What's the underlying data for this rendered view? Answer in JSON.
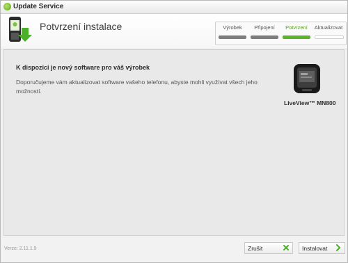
{
  "window": {
    "title": "Update Service"
  },
  "header": {
    "title": "Potvrzení instalace"
  },
  "steps": [
    {
      "label": "Výrobek",
      "state": "done"
    },
    {
      "label": "Připojení",
      "state": "done"
    },
    {
      "label": "Potvrzení",
      "state": "active"
    },
    {
      "label": "Aktualizovat",
      "state": "pending"
    }
  ],
  "content": {
    "heading": "K dispozici je nový software pro váš výrobek",
    "description": "Doporučujeme vám aktualizovat software vašeho telefonu, abyste mohli využívat všech jeho možností.",
    "device_name": "LiveView™ MN800"
  },
  "footer": {
    "version": "Verze: 2.11.1.9",
    "cancel_label": "Zrušit",
    "install_label": "Instalovat"
  },
  "colors": {
    "accent": "#5bb42a",
    "done_bar": "#7d7d7d"
  }
}
